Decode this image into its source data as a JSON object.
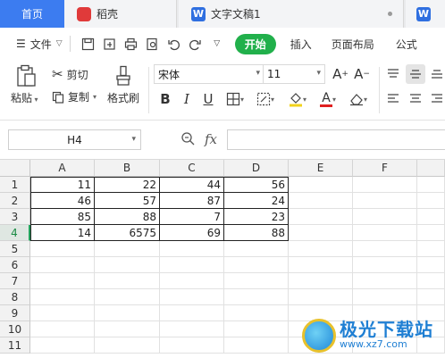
{
  "tabs": {
    "home": "首页",
    "daoke": "稻壳",
    "doc": "文字文稿1",
    "doc_logo": "W",
    "more_logo": "W"
  },
  "menu": {
    "file": "文件",
    "start": "开始",
    "insert": "插入",
    "page_layout": "页面布局",
    "formula": "公式"
  },
  "ribbon": {
    "paste": "粘贴",
    "cut": "剪切",
    "copy": "复制",
    "format_painter": "格式刷",
    "font_name": "宋体",
    "font_size": "11",
    "bold": "B",
    "italic": "I",
    "underline": "U",
    "grow_font": "A⁺",
    "shrink_font": "A⁻",
    "font_color_letter": "A"
  },
  "formula_bar": {
    "name_box": "H4",
    "fx": "fx",
    "value": ""
  },
  "sheet": {
    "columns": [
      "A",
      "B",
      "C",
      "D",
      "E",
      "F"
    ],
    "rows": [
      "1",
      "2",
      "3",
      "4",
      "5",
      "6",
      "7",
      "8",
      "9",
      "10",
      "11"
    ],
    "data": [
      [
        "11",
        "22",
        "44",
        "56"
      ],
      [
        "46",
        "57",
        "87",
        "24"
      ],
      [
        "85",
        "88",
        "7",
        "23"
      ],
      [
        "14",
        "6575",
        "69",
        "88"
      ]
    ],
    "active_row": "4",
    "selected_cell": "H4"
  },
  "watermark": {
    "title": "极光下载站",
    "url": "www.xz7.com"
  },
  "colors": {
    "home_tab": "#3c7cf0",
    "start_tab": "#21b04b",
    "selection": "#21a05a"
  }
}
